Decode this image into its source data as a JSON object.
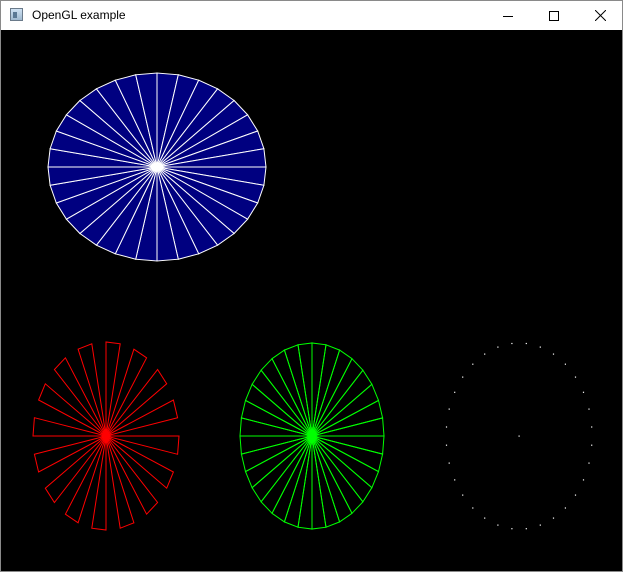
{
  "window": {
    "title": "OpenGL example"
  },
  "titlebar_icons": {
    "app": "app-window-icon",
    "minimize": "minimize-icon",
    "maximize": "maximize-icon",
    "close": "close-icon"
  },
  "scene": {
    "background": "#000000",
    "shapes": [
      {
        "name": "filled-blue-wheel",
        "style": "filled",
        "fill": "#000080",
        "stroke": "#ffffff",
        "segments": 32
      },
      {
        "name": "red-outline-star",
        "style": "star-outline",
        "stroke": "#ff0000",
        "segments": 32
      },
      {
        "name": "green-wire-wheel",
        "style": "wire",
        "stroke": "#00ff00",
        "segments": 32
      },
      {
        "name": "white-dotted-circle",
        "style": "points",
        "stroke": "#ffffff",
        "segments": 32
      }
    ]
  }
}
